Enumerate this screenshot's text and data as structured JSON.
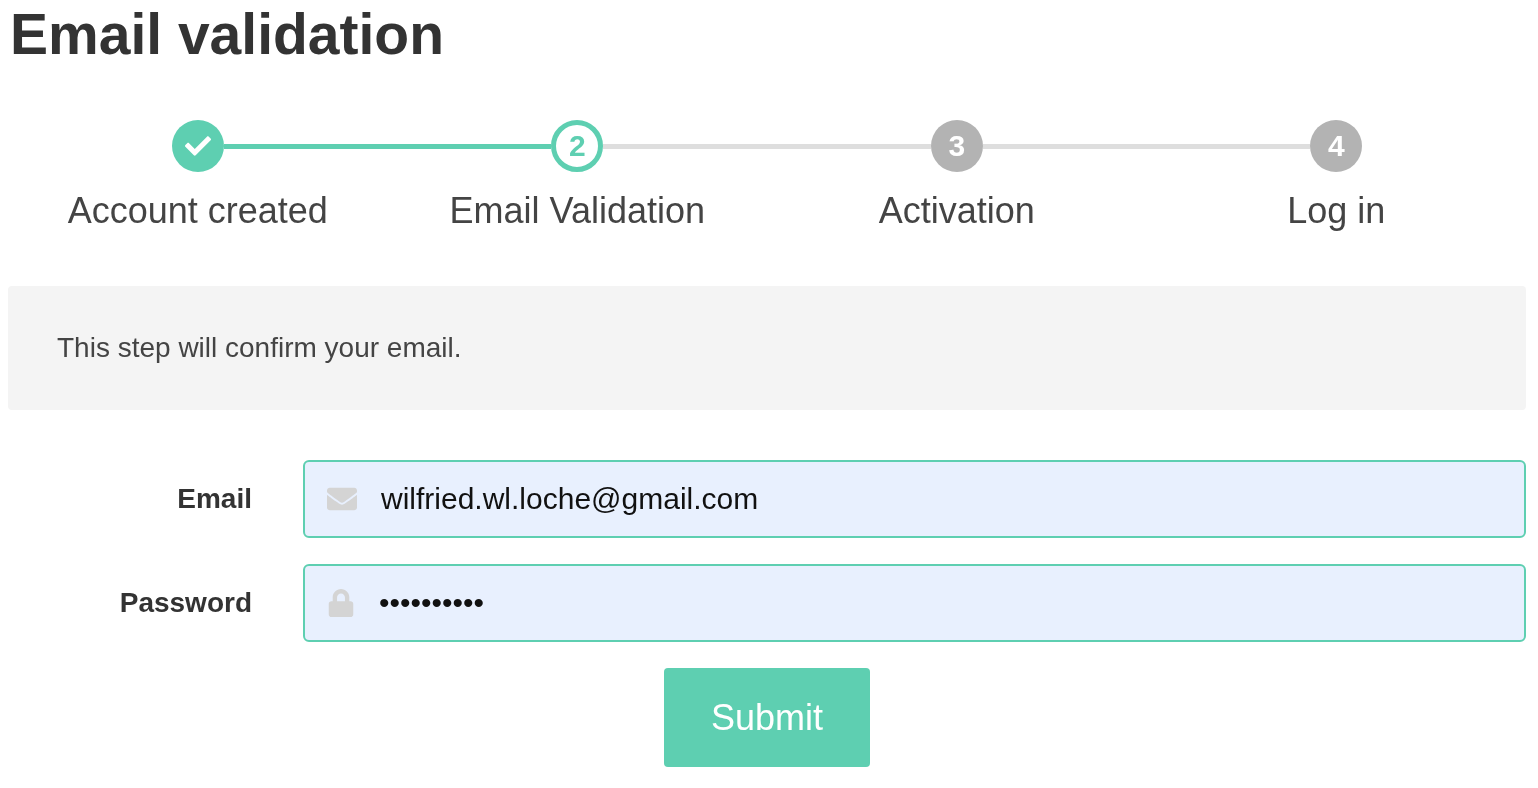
{
  "title": "Email validation",
  "steps": [
    {
      "label": "Account created",
      "done": true,
      "current": false
    },
    {
      "number": "2",
      "label": "Email Validation",
      "done": false,
      "current": true
    },
    {
      "number": "3",
      "label": "Activation",
      "done": false,
      "current": false
    },
    {
      "number": "4",
      "label": "Log in",
      "done": false,
      "current": false
    }
  ],
  "info": "This step will confirm your email.",
  "fields": [
    {
      "kind": "email",
      "label": "Email",
      "value": "wilfried.wl.loche@gmail.com"
    },
    {
      "kind": "password",
      "label": "Password",
      "value": "••••••••••"
    }
  ],
  "submit": "Submit"
}
